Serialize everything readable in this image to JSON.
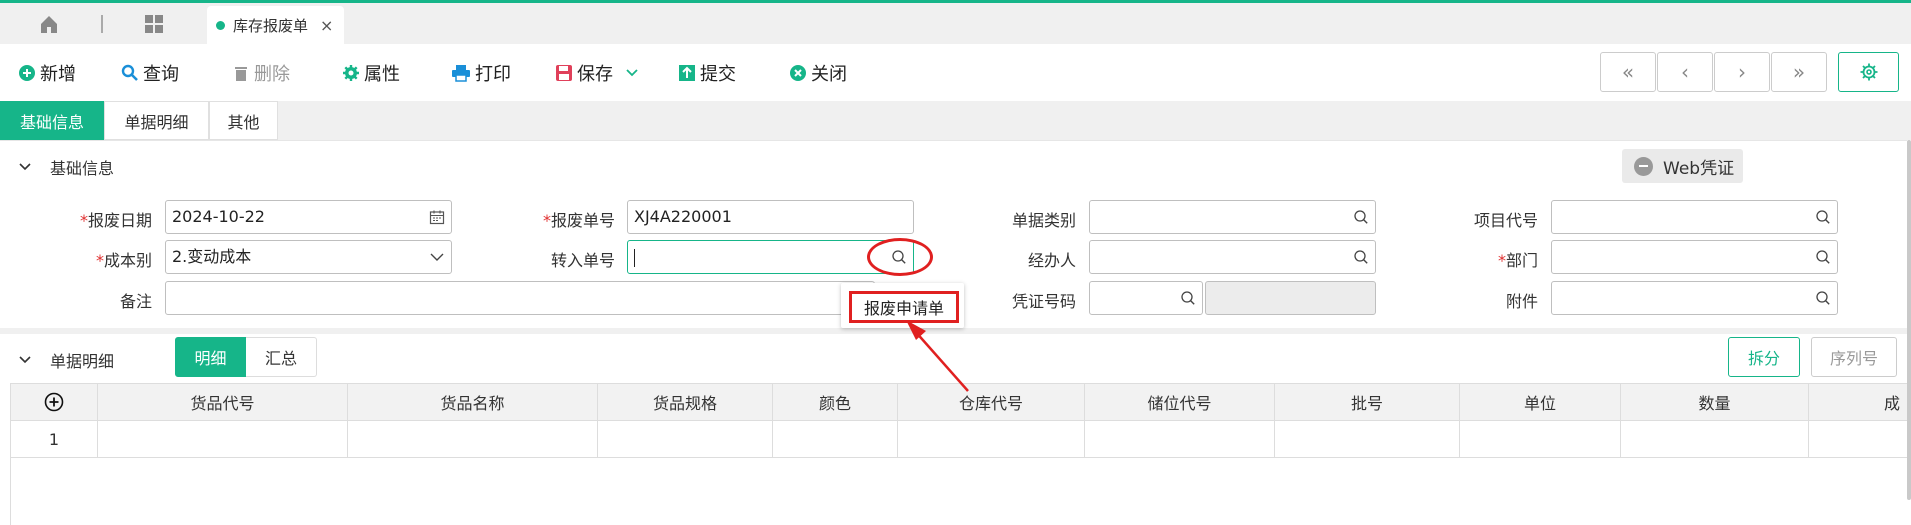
{
  "tabbar": {
    "home_icon": "home-icon",
    "apps_icon": "grid-icon",
    "tab_label": "库存报废单",
    "close_glyph": "×"
  },
  "toolbar": {
    "add": "新增",
    "query": "查询",
    "delete": "删除",
    "props": "属性",
    "print": "打印",
    "save": "保存",
    "submit": "提交",
    "close": "关闭",
    "nav_first": "«",
    "nav_prev": "‹",
    "nav_next": "›",
    "nav_last": "»"
  },
  "subtabs": [
    "基础信息",
    "单据明细",
    "其他"
  ],
  "section1": {
    "title": "基础信息",
    "web_voucher": "Web凭证",
    "fields": {
      "scrap_date_label": "报废日期",
      "scrap_date_value": "2024-10-22",
      "scrap_no_label": "报废单号",
      "scrap_no_value": "XJ4A220001",
      "doc_type_label": "单据类别",
      "project_label": "项目代号",
      "cost_label": "成本别",
      "cost_value": "2.变动成本",
      "transfer_no_label": "转入单号",
      "handler_label": "经办人",
      "dept_label": "部门",
      "remark_label": "备注",
      "voucher_label": "凭证号码",
      "attach_label": "附件",
      "required_mark": "*"
    }
  },
  "popup": {
    "item": "报废申请单"
  },
  "section2": {
    "title": "单据明细",
    "seg_detail": "明细",
    "seg_summary": "汇总",
    "split": "拆分",
    "serial": "序列号",
    "columns": [
      "货品代号",
      "货品名称",
      "货品规格",
      "颜色",
      "仓库代号",
      "储位代号",
      "批号",
      "单位",
      "数量",
      "成"
    ],
    "rows": [
      [
        "1"
      ]
    ]
  },
  "colors": {
    "accent": "#16b589",
    "annotation_red": "#e02020"
  }
}
